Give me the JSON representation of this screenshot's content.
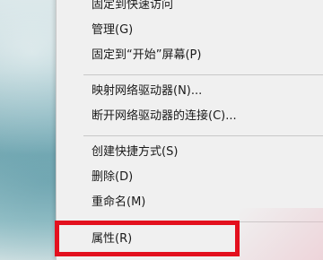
{
  "context_menu": {
    "items": [
      {
        "label": "固定到快速访问"
      },
      {
        "label": "管理(G)"
      },
      {
        "label": "固定到“开始”屏幕(P)"
      },
      {
        "label": "映射网络驱动器(N)..."
      },
      {
        "label": "断开网络驱动器的连接(C)..."
      },
      {
        "label": "创建快捷方式(S)"
      },
      {
        "label": "删除(D)"
      },
      {
        "label": "重命名(M)"
      },
      {
        "label": "属性(R)"
      }
    ]
  },
  "colors": {
    "menu_background": "#f0f0f0",
    "highlight_border": "#e3101e",
    "separator": "#c8c8c8"
  }
}
